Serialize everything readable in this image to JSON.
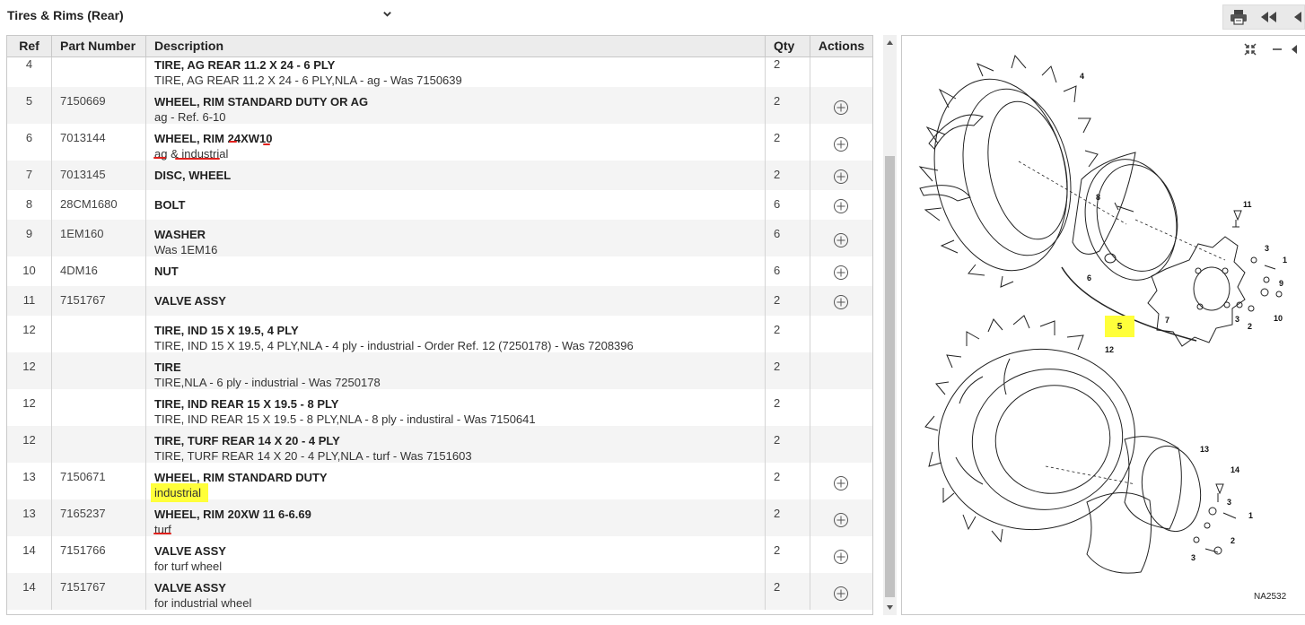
{
  "section_select": {
    "value": "Tires & Rims (Rear)"
  },
  "toolbar": {
    "print_icon": "printer-icon",
    "back_icon": "double-left-arrow-icon"
  },
  "table": {
    "headers": {
      "ref": "Ref",
      "part_number": "Part Number",
      "description": "Description",
      "qty": "Qty",
      "actions": "Actions"
    },
    "rows": [
      {
        "ref": "4",
        "part": "",
        "title": "TIRE, AG REAR 11.2 X 24 - 6 PLY",
        "sub": "TIRE, AG REAR 11.2 X 24 - 6 PLY,NLA - ag - Was 7150639",
        "qty": "2",
        "add": false
      },
      {
        "ref": "5",
        "part": "7150669",
        "title": "WHEEL, RIM STANDARD DUTY OR AG",
        "sub": "ag - Ref. 6-10",
        "qty": "2",
        "add": true
      },
      {
        "ref": "6",
        "part": "7013144",
        "title": "WHEEL, RIM 24XW10",
        "sub": "ag & industrial",
        "qty": "2",
        "add": true
      },
      {
        "ref": "7",
        "part": "7013145",
        "title": "DISC, WHEEL",
        "sub": "",
        "qty": "2",
        "add": true
      },
      {
        "ref": "8",
        "part": "28CM1680",
        "title": "BOLT",
        "sub": "",
        "qty": "6",
        "add": true
      },
      {
        "ref": "9",
        "part": "1EM160",
        "title": "WASHER",
        "sub": "Was 1EM16",
        "qty": "6",
        "add": true
      },
      {
        "ref": "10",
        "part": "4DM16",
        "title": "NUT",
        "sub": "",
        "qty": "6",
        "add": true
      },
      {
        "ref": "11",
        "part": "7151767",
        "title": "VALVE ASSY",
        "sub": "",
        "qty": "2",
        "add": true
      },
      {
        "ref": "12",
        "part": "",
        "title": "TIRE, IND 15 X 19.5, 4 PLY",
        "sub": "TIRE, IND 15 X 19.5, 4 PLY,NLA - 4 ply - industrial - Order Ref. 12 (7250178) - Was 7208396",
        "qty": "2",
        "add": false
      },
      {
        "ref": "12",
        "part": "",
        "title": "TIRE",
        "sub": "TIRE,NLA - 6 ply - industrial - Was 7250178",
        "qty": "2",
        "add": false
      },
      {
        "ref": "12",
        "part": "",
        "title": "TIRE, IND REAR 15 X 19.5 - 8 PLY",
        "sub": "TIRE, IND REAR 15 X 19.5 - 8 PLY,NLA - 8 ply - industiral - Was 7150641",
        "qty": "2",
        "add": false
      },
      {
        "ref": "12",
        "part": "",
        "title": "TIRE, TURF REAR 14 X 20 - 4 PLY",
        "sub": "TIRE, TURF REAR 14 X 20 - 4 PLY,NLA - turf - Was 7151603",
        "qty": "2",
        "add": false
      },
      {
        "ref": "13",
        "part": "7150671",
        "title": "WHEEL, RIM STANDARD DUTY",
        "sub": "industrial",
        "qty": "2",
        "add": true
      },
      {
        "ref": "13",
        "part": "7165237",
        "title": "WHEEL, RIM 20XW 11 6-6.69",
        "sub": "turf",
        "qty": "2",
        "add": true
      },
      {
        "ref": "14",
        "part": "7151766",
        "title": "VALVE ASSY",
        "sub": "for turf wheel",
        "qty": "2",
        "add": true
      },
      {
        "ref": "14",
        "part": "7151767",
        "title": "VALVE ASSY",
        "sub": "for industrial wheel",
        "qty": "2",
        "add": true
      }
    ]
  },
  "diagram": {
    "id_label": "NA2532",
    "callouts": [
      "4",
      "8",
      "11",
      "3",
      "1",
      "6",
      "9",
      "10",
      "7",
      "3",
      "2",
      "5",
      "12",
      "13",
      "14",
      "3",
      "1",
      "2",
      "3"
    ],
    "highlight_color": "#ffff3a",
    "annotation_color": "#e0201c"
  }
}
